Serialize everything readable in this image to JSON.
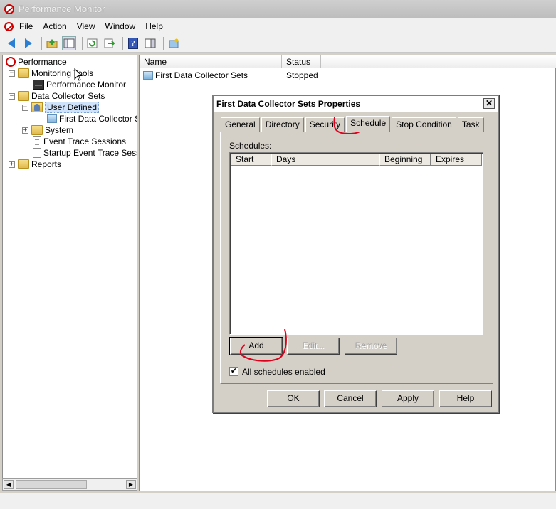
{
  "window": {
    "title": "Performance Monitor"
  },
  "menu": {
    "items": [
      "File",
      "Action",
      "View",
      "Window",
      "Help"
    ]
  },
  "toolbar": {
    "buttons": [
      "back-icon",
      "forward-icon",
      "up-folder-icon",
      "show-hide-tree-icon",
      "refresh-icon",
      "export-list-icon",
      "help-icon",
      "properties-pane-icon",
      "new-dataset-icon"
    ]
  },
  "tree": {
    "items": [
      {
        "label": "Performance",
        "icon": "performance-icon"
      },
      {
        "label": "Monitoring Tools",
        "icon": "folder-icon",
        "expander": "−"
      },
      {
        "label": "Performance Monitor",
        "icon": "performance-monitor-icon"
      },
      {
        "label": "Data Collector Sets",
        "icon": "folder-icon",
        "expander": "−"
      },
      {
        "label": "User Defined",
        "icon": "user-folder-icon",
        "expander": "−",
        "selected": true
      },
      {
        "label": "First Data Collector Se",
        "icon": "data-collector-set-icon"
      },
      {
        "label": "System",
        "icon": "folder-icon",
        "expander": "+"
      },
      {
        "label": "Event Trace Sessions",
        "icon": "trace-doc-icon"
      },
      {
        "label": "Startup Event Trace Sess",
        "icon": "trace-doc-icon"
      },
      {
        "label": "Reports",
        "icon": "folder-icon",
        "expander": "+"
      }
    ]
  },
  "list": {
    "columns": [
      "Name",
      "Status"
    ],
    "rows": [
      {
        "name": "First Data Collector Sets",
        "status": "Stopped"
      }
    ]
  },
  "dialog": {
    "title": "First Data Collector Sets Properties",
    "close": "✕",
    "tabs": [
      "General",
      "Directory",
      "Security",
      "Schedule",
      "Stop Condition",
      "Task"
    ],
    "active_tab": "Schedule",
    "schedules_label": "Schedules:",
    "columns": [
      "Start",
      "Days",
      "Beginning",
      "Expires"
    ],
    "buttons": {
      "add": "Add",
      "edit": "Edit...",
      "remove": "Remove"
    },
    "checkbox": {
      "label": "All schedules enabled",
      "checked": "✔"
    },
    "footer": {
      "ok": "OK",
      "cancel": "Cancel",
      "apply": "Apply",
      "help": "Help"
    }
  },
  "colors": {
    "annotation": "#e0001b",
    "selection": "#cfe3fa"
  }
}
